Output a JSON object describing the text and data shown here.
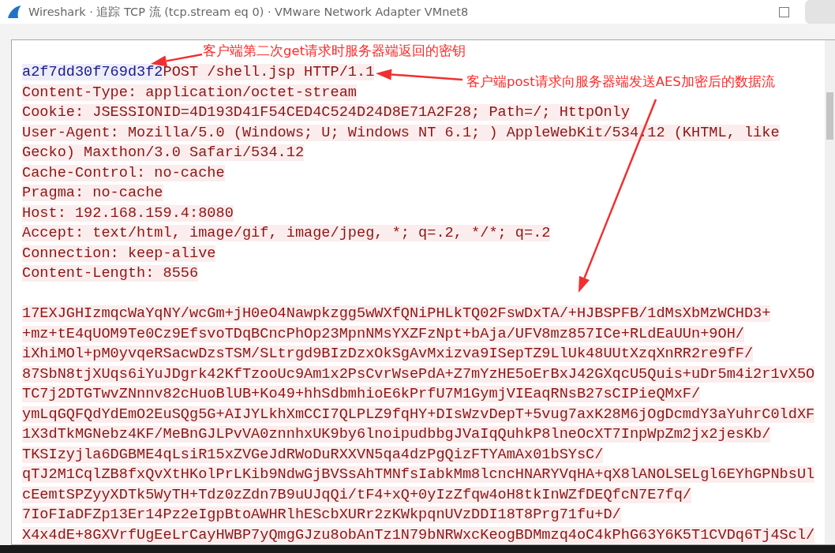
{
  "window": {
    "title": "Wireshark · 追踪 TCP 流 (tcp.stream eq 0) · VMware Network Adapter VMnet8"
  },
  "stream": {
    "header_lines": [
      {
        "parts": [
          {
            "text": "a2f7dd30f769d3f2",
            "kind": "server"
          },
          {
            "text": "POST /shell.jsp HTTP/1.1",
            "kind": "client"
          }
        ]
      },
      {
        "parts": [
          {
            "text": "Content-Type: application/octet-stream",
            "kind": "client"
          }
        ]
      },
      {
        "parts": [
          {
            "text": "Cookie: JSESSIONID=4D193D41F54CED4C524D24D8E71A2F28; Path=/; HttpOnly",
            "kind": "client"
          }
        ]
      },
      {
        "parts": [
          {
            "text": "User-Agent: Mozilla/5.0 (Windows; U; Windows NT 6.1; ) AppleWebKit/534.12 (KHTML, like",
            "kind": "client"
          }
        ]
      },
      {
        "parts": [
          {
            "text": "Gecko) Maxthon/3.0 Safari/534.12",
            "kind": "client"
          }
        ]
      },
      {
        "parts": [
          {
            "text": "Cache-Control: no-cache",
            "kind": "client"
          }
        ]
      },
      {
        "parts": [
          {
            "text": "Pragma: no-cache",
            "kind": "client"
          }
        ]
      },
      {
        "parts": [
          {
            "text": "Host: 192.168.159.4:8080",
            "kind": "client"
          }
        ]
      },
      {
        "parts": [
          {
            "text": "Accept: text/html, image/gif, image/jpeg, *; q=.2, */*; q=.2",
            "kind": "client"
          }
        ]
      },
      {
        "parts": [
          {
            "text": "Connection: keep-alive",
            "kind": "client"
          }
        ]
      },
      {
        "parts": [
          {
            "text": "Content-Length: 8556",
            "kind": "client"
          }
        ]
      }
    ],
    "body_lines": [
      {
        "parts": [
          {
            "text": "17EXJGHIzmqcWaYqNY/wcGm+jH0eO4Nawpkzgg5wWXfQNiPHLkTQ02FswDxTA/+HJBSPFB/1dMsXbMzWCHD3+",
            "kind": "client"
          }
        ]
      },
      {
        "parts": [
          {
            "text": "+mz+tE4qUOM9Te0Cz9EfsvoTDqBCncPhOp23MpnNMsYXZFzNpt+bAja/UFV8mz857ICe+RLdEaUUn+9OH/",
            "kind": "client"
          }
        ]
      },
      {
        "parts": [
          {
            "text": "iXhiMOl+pM0yvqeRSacwDzsTSM/SLtrgd9BIzDzxOkSgAvMxizva9ISepTZ9LlUk48UUtXzqXnRR2re9fF/",
            "kind": "client"
          }
        ]
      },
      {
        "parts": [
          {
            "text": "87SbN8tjXUqs6iYuJDgrk42KfTzooUc9Am1x2PsCvrWsePdA+Z7mYzHE5oErBxJ42GXqcU5Quis+uDr5m4i2r1vX5O",
            "kind": "client"
          }
        ]
      },
      {
        "parts": [
          {
            "text": "TC7j2DTGTwvZNnnv82cHuoBlUB+Ko49+hhSdbmhioE6kPrfU7M1GymjVIEaqRNsB27sCIPieQMxF/",
            "kind": "client"
          }
        ]
      },
      {
        "parts": [
          {
            "text": "ymLqGQFQdYdEmO2EuSQg5G+AIJYLkhXmCCI7QLPLZ9fqHY+DIsWzvDepT+5vug7axK28M6jOgDcmdY3aYuhrC0ldXF",
            "kind": "client"
          }
        ]
      },
      {
        "parts": [
          {
            "text": "1X3dTkMGNebz4KF/MeBnGJLPvVA0znnhxUK9by6lnoipudbbgJVaIqQuhkP8lneOcXT7InpWpZm2jx2jesKb/",
            "kind": "client"
          }
        ]
      },
      {
        "parts": [
          {
            "text": "TKSIzyjla6DGBME4qLsiR15xZVGeJdRWoDuRXXVN5qa4dzPgQizFTYAmAx01bSYsC/",
            "kind": "client"
          }
        ]
      },
      {
        "parts": [
          {
            "text": "qTJ2M1CqlZB8fxQvXtHKolPrLKib9NdwGjBVSsAhTMNfsIabkMm8lcncHNARYVqHA+qX8lANOLSELgl6EYhGPNbsUl",
            "kind": "client"
          }
        ]
      },
      {
        "parts": [
          {
            "text": "cEemtSPZyyXDTk5WyTH+Tdz0zZdn7B9uUJqQi/tF4+xQ+0yIzZfqw4oH8tkInWZfDEQfcN7E7fq/",
            "kind": "client"
          }
        ]
      },
      {
        "parts": [
          {
            "text": "7IoFIaDFZp13Er14Pz2eIgpBtoAWHRlhEScbXURr2zKWkpqnUVzDDI18T8Prg71fu+D/",
            "kind": "client"
          }
        ]
      },
      {
        "parts": [
          {
            "text": "X4x4dE+8GXVrfUgEeLrCayHWBP7yQmgGJzu8obAnTz1N79bNRWxcKeogBDMmzq4oC4kPhG63Y6K5T1CVDq6Tj4Scl/",
            "kind": "client"
          }
        ]
      }
    ]
  },
  "annotations": [
    {
      "text": "客户端第二次get请求时服务器端返回的密钥"
    },
    {
      "text": "客户端post请求向服务器端发送AES加密后的数据流"
    }
  ]
}
